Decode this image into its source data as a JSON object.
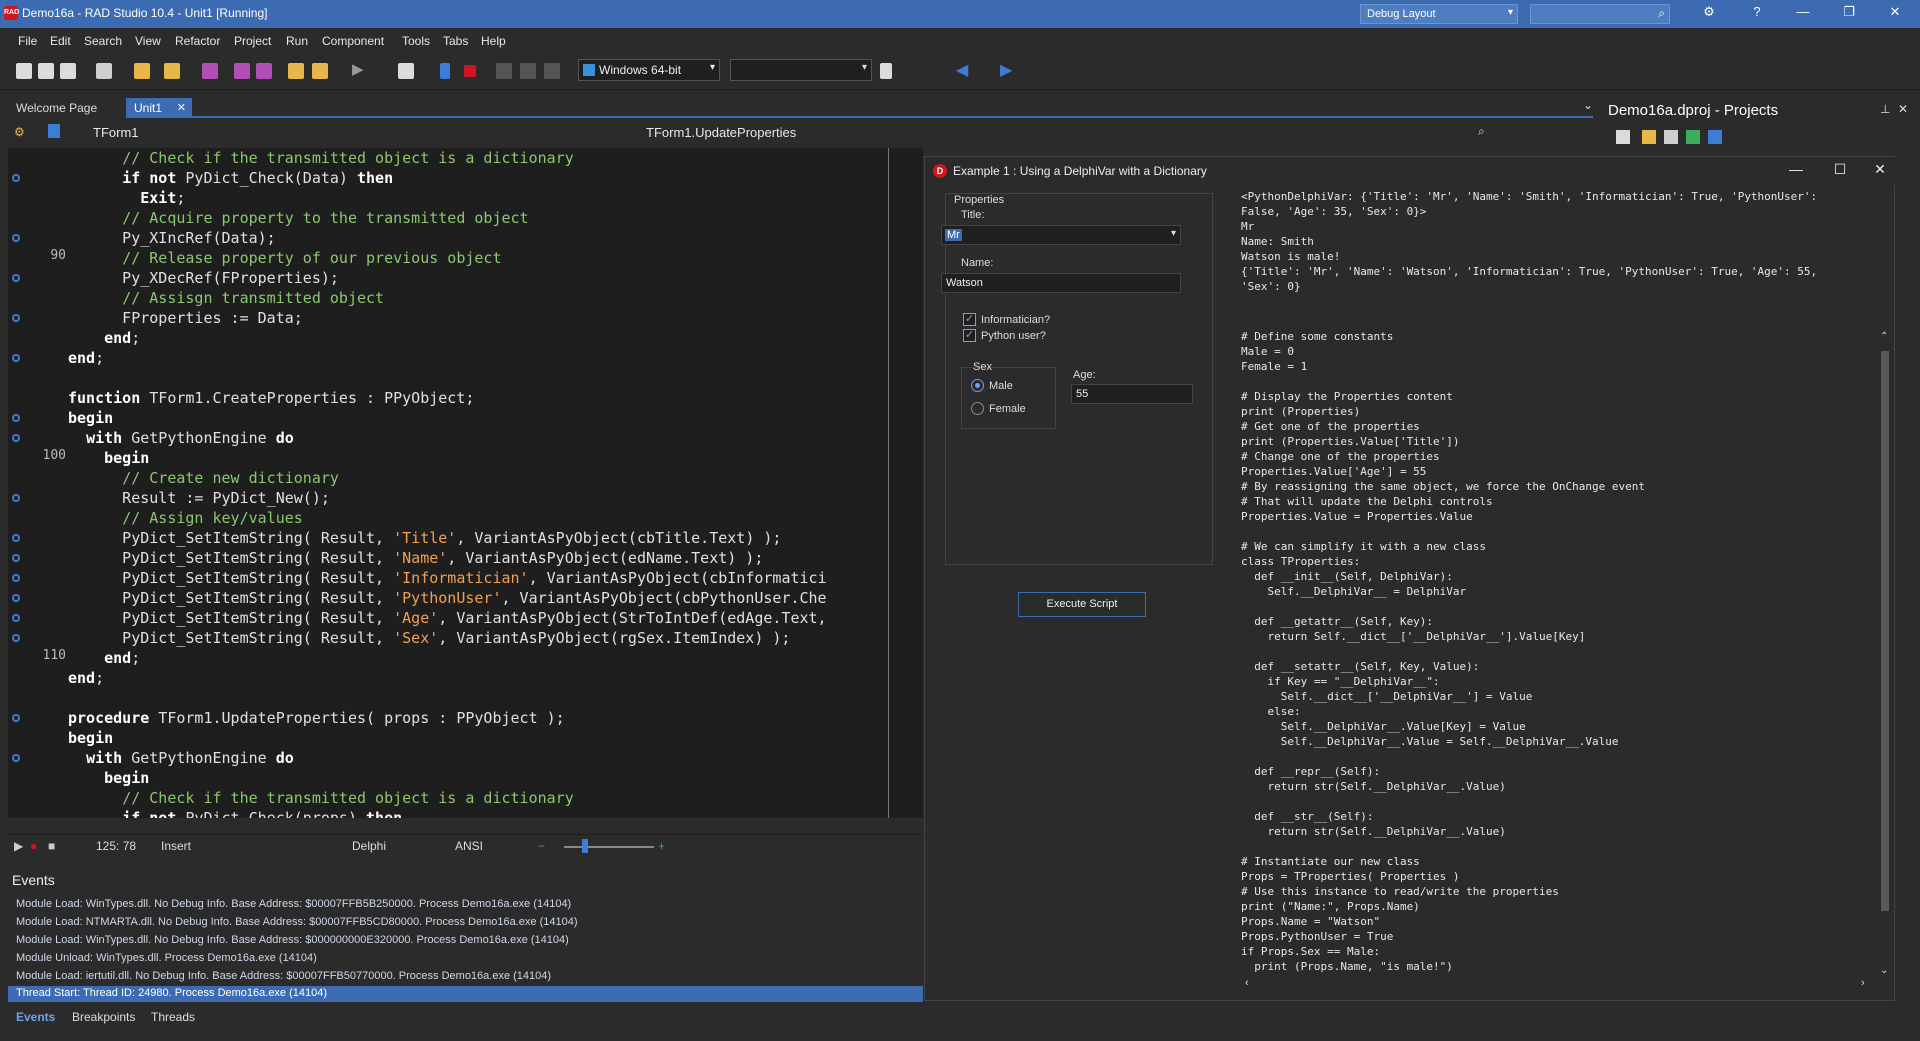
{
  "ide": {
    "title": "Demo16a - RAD Studio 10.4 - Unit1 [Running]",
    "layout_combo": "Debug Layout",
    "menu": [
      "File",
      "Edit",
      "Search",
      "View",
      "Refactor",
      "Project",
      "Run",
      "Component",
      "Tools",
      "Tabs",
      "Help"
    ],
    "platform": "Windows 64-bit",
    "tabs": [
      "Welcome Page",
      "Unit1"
    ],
    "nav_class": "TForm1",
    "nav_method": "TForm1.UpdateProperties",
    "projects_title": "Demo16a.dproj - Projects"
  },
  "editor": {
    "line_numbers": {
      "90": "90",
      "100": "100",
      "110": "110"
    },
    "lines": [
      "      // Check if the transmitted object is a dictionary",
      "      if not PyDict_Check(Data) then",
      "        Exit;",
      "      // Acquire property to the transmitted object",
      "      Py_XIncRef(Data);",
      "      // Release property of our previous object",
      "      Py_XDecRef(FProperties);",
      "      // Assisgn transmitted object",
      "      FProperties := Data;",
      "    end;",
      "end;",
      "",
      "function TForm1.CreateProperties : PPyObject;",
      "begin",
      "  with GetPythonEngine do",
      "    begin",
      "      // Create new dictionary",
      "      Result := PyDict_New();",
      "      // Assign key/values",
      "      PyDict_SetItemString( Result, 'Title', VariantAsPyObject(cbTitle.Text) );",
      "      PyDict_SetItemString( Result, 'Name', VariantAsPyObject(edName.Text) );",
      "      PyDict_SetItemString( Result, 'Informatician', VariantAsPyObject(cbInformatici",
      "      PyDict_SetItemString( Result, 'PythonUser', VariantAsPyObject(cbPythonUser.Che",
      "      PyDict_SetItemString( Result, 'Age', VariantAsPyObject(StrToIntDef(edAge.Text,",
      "      PyDict_SetItemString( Result, 'Sex', VariantAsPyObject(rgSex.ItemIndex) );",
      "    end;",
      "end;",
      "",
      "procedure TForm1.UpdateProperties( props : PPyObject );",
      "begin",
      "  with GetPythonEngine do",
      "    begin",
      "      // Check if the transmitted object is a dictionary",
      "      if not PyDict_Check(props) then"
    ],
    "status": {
      "position": "125: 78",
      "mode": "Insert",
      "language": "Delphi",
      "encoding": "ANSI"
    }
  },
  "events": {
    "title": "Events",
    "lines": [
      "Module Load: WinTypes.dll. No Debug Info. Base Address: $00007FFB5B250000. Process Demo16a.exe (14104)",
      "Module Load: NTMARTA.dll. No Debug Info. Base Address: $00007FFB5CD80000. Process Demo16a.exe (14104)",
      "Module Load: WinTypes.dll. No Debug Info. Base Address: $000000000E320000. Process Demo16a.exe (14104)",
      "Module Unload: WinTypes.dll. Process Demo16a.exe (14104)",
      "Module Load: iertutil.dll. No Debug Info. Base Address: $00007FFB50770000. Process Demo16a.exe (14104)",
      "Thread Start: Thread ID: 24980. Process Demo16a.exe (14104)"
    ],
    "tabs": [
      "Events",
      "Breakpoints",
      "Threads"
    ]
  },
  "app": {
    "title": "Example 1 : Using a DelphiVar with a Dictionary",
    "group_label": "Properties",
    "title_label": "Title:",
    "title_value": "Mr",
    "name_label": "Name:",
    "name_value": "Watson",
    "informatician_label": "Informatician?",
    "python_user_label": "Python user?",
    "sex_label": "Sex",
    "male_label": "Male",
    "female_label": "Female",
    "age_label": "Age:",
    "age_value": "55",
    "execute_label": "Execute Script",
    "output": [
      "<PythonDelphiVar: {'Title': 'Mr', 'Name': 'Smith', 'Informatician': True, 'PythonUser':",
      "False, 'Age': 35, 'Sex': 0}>",
      "Mr",
      "Name: Smith",
      "Watson is male!",
      "{'Title': 'Mr', 'Name': 'Watson', 'Informatician': True, 'PythonUser': True, 'Age': 55,",
      "'Sex': 0}"
    ],
    "script": [
      "# Define some constants",
      "Male = 0",
      "Female = 1",
      "",
      "# Display the Properties content",
      "print (Properties)",
      "# Get one of the properties",
      "print (Properties.Value['Title'])",
      "# Change one of the properties",
      "Properties.Value['Age'] = 55",
      "# By reassigning the same object, we force the OnChange event",
      "# That will update the Delphi controls",
      "Properties.Value = Properties.Value",
      "",
      "# We can simplify it with a new class",
      "class TProperties:",
      "  def __init__(Self, DelphiVar):",
      "    Self.__DelphiVar__ = DelphiVar",
      "",
      "  def __getattr__(Self, Key):",
      "    return Self.__dict__['__DelphiVar__'].Value[Key]",
      "",
      "  def __setattr__(Self, Key, Value):",
      "    if Key == \"__DelphiVar__\":",
      "      Self.__dict__['__DelphiVar__'] = Value",
      "    else:",
      "      Self.__DelphiVar__.Value[Key] = Value",
      "      Self.__DelphiVar__.Value = Self.__DelphiVar__.Value",
      "",
      "  def __repr__(Self):",
      "    return str(Self.__DelphiVar__.Value)",
      "",
      "  def __str__(Self):",
      "    return str(Self.__DelphiVar__.Value)",
      "",
      "# Instantiate our new class",
      "Props = TProperties( Properties )",
      "# Use this instance to read/write the properties",
      "print (\"Name:\", Props.Name)",
      "Props.Name = \"Watson\"",
      "Props.PythonUser = True",
      "if Props.Sex == Male:",
      "  print (Props.Name, \"is male!\")"
    ]
  },
  "colors": {
    "accent": "#3c6bb1",
    "comment": "#8bc76e",
    "string": "#f0a050"
  }
}
